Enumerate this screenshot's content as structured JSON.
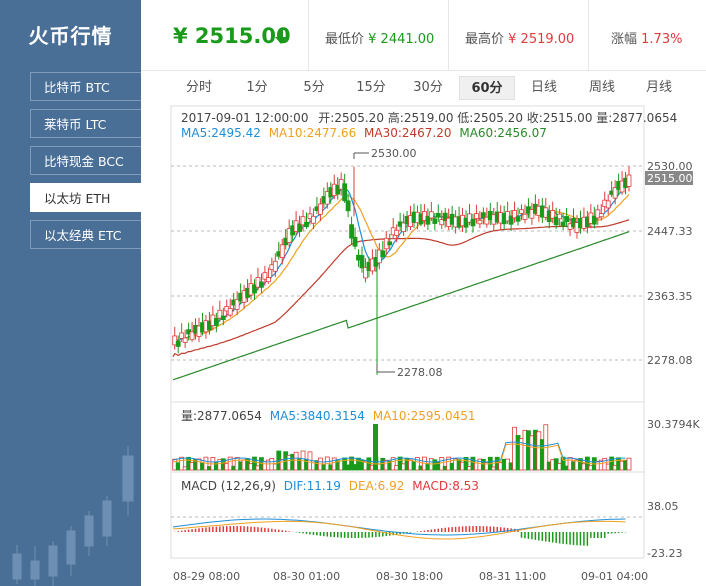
{
  "sidebar": {
    "brand": "火币行情",
    "items": [
      {
        "label": "比特币 BTC"
      },
      {
        "label": "莱特币 LTC"
      },
      {
        "label": "比特现金 BCC"
      },
      {
        "label": "以太坊 ETH"
      },
      {
        "label": "以太经典 ETC"
      }
    ],
    "active_index": 3
  },
  "ticker": {
    "price": "¥ 2515.00",
    "trend_icon": "arrow-down-icon",
    "low_label": "最低价",
    "low_value": "¥ 2441.00",
    "high_label": "最高价",
    "high_value": "¥ 2519.00",
    "change_label": "涨幅",
    "change_value": "1.73%"
  },
  "tabs": [
    "分时",
    "1分",
    "5分",
    "15分",
    "30分",
    "60分",
    "日线",
    "周线",
    "月线"
  ],
  "active_tab": 5,
  "colors": {
    "up": "#e03a3a",
    "down": "#1a9a1a",
    "ma5": "#1f8fd8",
    "ma10": "#f0a020",
    "ma30": "#c0392b",
    "ma60": "#2a8a2a",
    "sidebar": "#4a6f96"
  },
  "chart_data": [
    {
      "type": "candlestick",
      "info_line": {
        "time": "2017-09-01 12:00:00",
        "open": "开:2505.20",
        "high": "高:2519.00",
        "low": "低:2505.20",
        "close": "收:2515.00",
        "volume": "量:2877.0654"
      },
      "ma_line": {
        "ma5": "MA5:2495.42",
        "ma10": "MA10:2477.66",
        "ma30": "MA30:2467.20",
        "ma60": "MA60:2456.07"
      },
      "y_ticks": [
        "2530.00",
        "2447.33",
        "2363.35",
        "2278.08"
      ],
      "y_range": [
        2250,
        2560
      ],
      "current_price_tag": "2515.00",
      "annotations": {
        "max": "2530.00",
        "min": "2278.08"
      },
      "x_labels": [
        "08-29 08:00",
        "08-30 01:00",
        "08-30 18:00",
        "08-31 11:00",
        "09-01 04:00"
      ]
    },
    {
      "type": "bar",
      "legend": {
        "vol": "量:2877.0654",
        "ma5": "MA5:3840.3154",
        "ma10": "MA10:2595.0451"
      },
      "y_ticks": [
        "30.3794K"
      ]
    },
    {
      "type": "line",
      "legend": {
        "title": "MACD (12,26,9)",
        "dif": "DIF:11.19",
        "dea": "DEA:6.92",
        "macd": "MACD:8.53"
      },
      "y_ticks": [
        "38.05",
        "-23.23"
      ]
    }
  ]
}
